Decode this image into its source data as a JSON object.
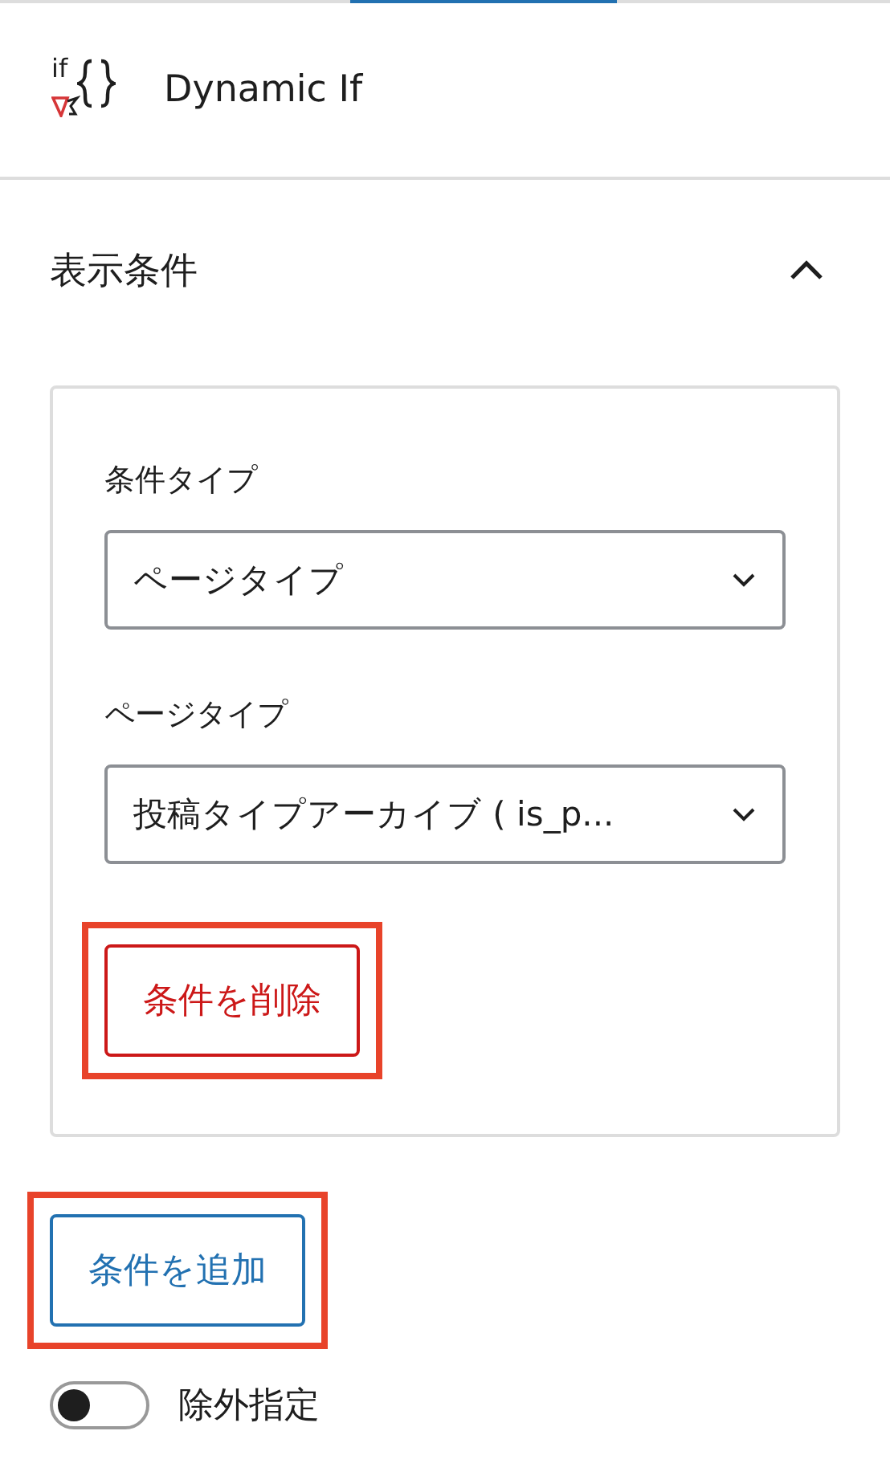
{
  "block": {
    "logo_text": "if",
    "title": "Dynamic If"
  },
  "panel": {
    "title": "表示条件",
    "expanded": true,
    "fields": [
      {
        "label": "条件タイプ",
        "value": "ページタイプ"
      },
      {
        "label": "ページタイプ",
        "value": "投稿タイプアーカイブ ( is_p..."
      }
    ],
    "remove_button": {
      "label": "条件を削除",
      "highlighted": true
    }
  },
  "add_button": {
    "label": "条件を追加",
    "highlighted": true
  },
  "exclude_toggle": {
    "label": "除外指定",
    "on": false
  }
}
